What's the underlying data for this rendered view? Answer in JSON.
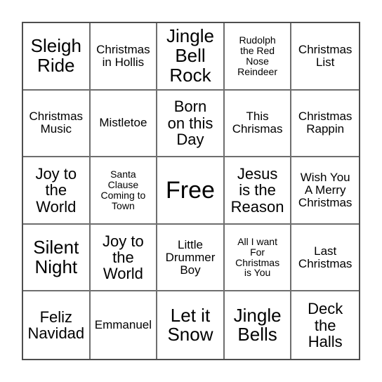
{
  "card": {
    "type": "bingo-card",
    "columns": 5,
    "rows": 5,
    "free_space": {
      "row": 3,
      "column": 3,
      "label": "Free"
    },
    "colors": {
      "background": "#ffffff",
      "text": "#000000",
      "outer_border": "#4d4d4d",
      "grid_line": "#6e6e6e"
    },
    "cells": [
      {
        "text": "Sleigh\nRide",
        "size": "s-lg"
      },
      {
        "text": "Christmas\nin Hollis",
        "size": "s-sm"
      },
      {
        "text": "Jingle\nBell\nRock",
        "size": "s-lg"
      },
      {
        "text": "Rudolph\nthe Red\nNose\nReindeer",
        "size": "s-xs"
      },
      {
        "text": "Christmas\nList",
        "size": "s-sm"
      },
      {
        "text": "Christmas\nMusic",
        "size": "s-sm"
      },
      {
        "text": "Mistletoe",
        "size": "s-sm"
      },
      {
        "text": "Born\non this\nDay",
        "size": "s-md"
      },
      {
        "text": "This\nChrismas",
        "size": "s-sm"
      },
      {
        "text": "Christmas\nRappin",
        "size": "s-sm"
      },
      {
        "text": "Joy to\nthe\nWorld",
        "size": "s-md"
      },
      {
        "text": "Santa\nClause\nComing to\nTown",
        "size": "s-xs"
      },
      {
        "text": "Free",
        "size": "s-xl"
      },
      {
        "text": "Jesus\nis the\nReason",
        "size": "s-md"
      },
      {
        "text": "Wish You\nA Merry\nChristmas",
        "size": "s-sm"
      },
      {
        "text": "Silent\nNight",
        "size": "s-lg"
      },
      {
        "text": "Joy to\nthe\nWorld",
        "size": "s-md"
      },
      {
        "text": "Little\nDrummer\nBoy",
        "size": "s-sm"
      },
      {
        "text": "All I want\nFor\nChristmas\nis You",
        "size": "s-xs"
      },
      {
        "text": "Last\nChristmas",
        "size": "s-sm"
      },
      {
        "text": "Feliz\nNavidad",
        "size": "s-md"
      },
      {
        "text": "Emmanuel",
        "size": "s-sm"
      },
      {
        "text": "Let it\nSnow",
        "size": "s-lg"
      },
      {
        "text": "Jingle\nBells",
        "size": "s-lg"
      },
      {
        "text": "Deck\nthe\nHalls",
        "size": "s-md"
      }
    ]
  }
}
